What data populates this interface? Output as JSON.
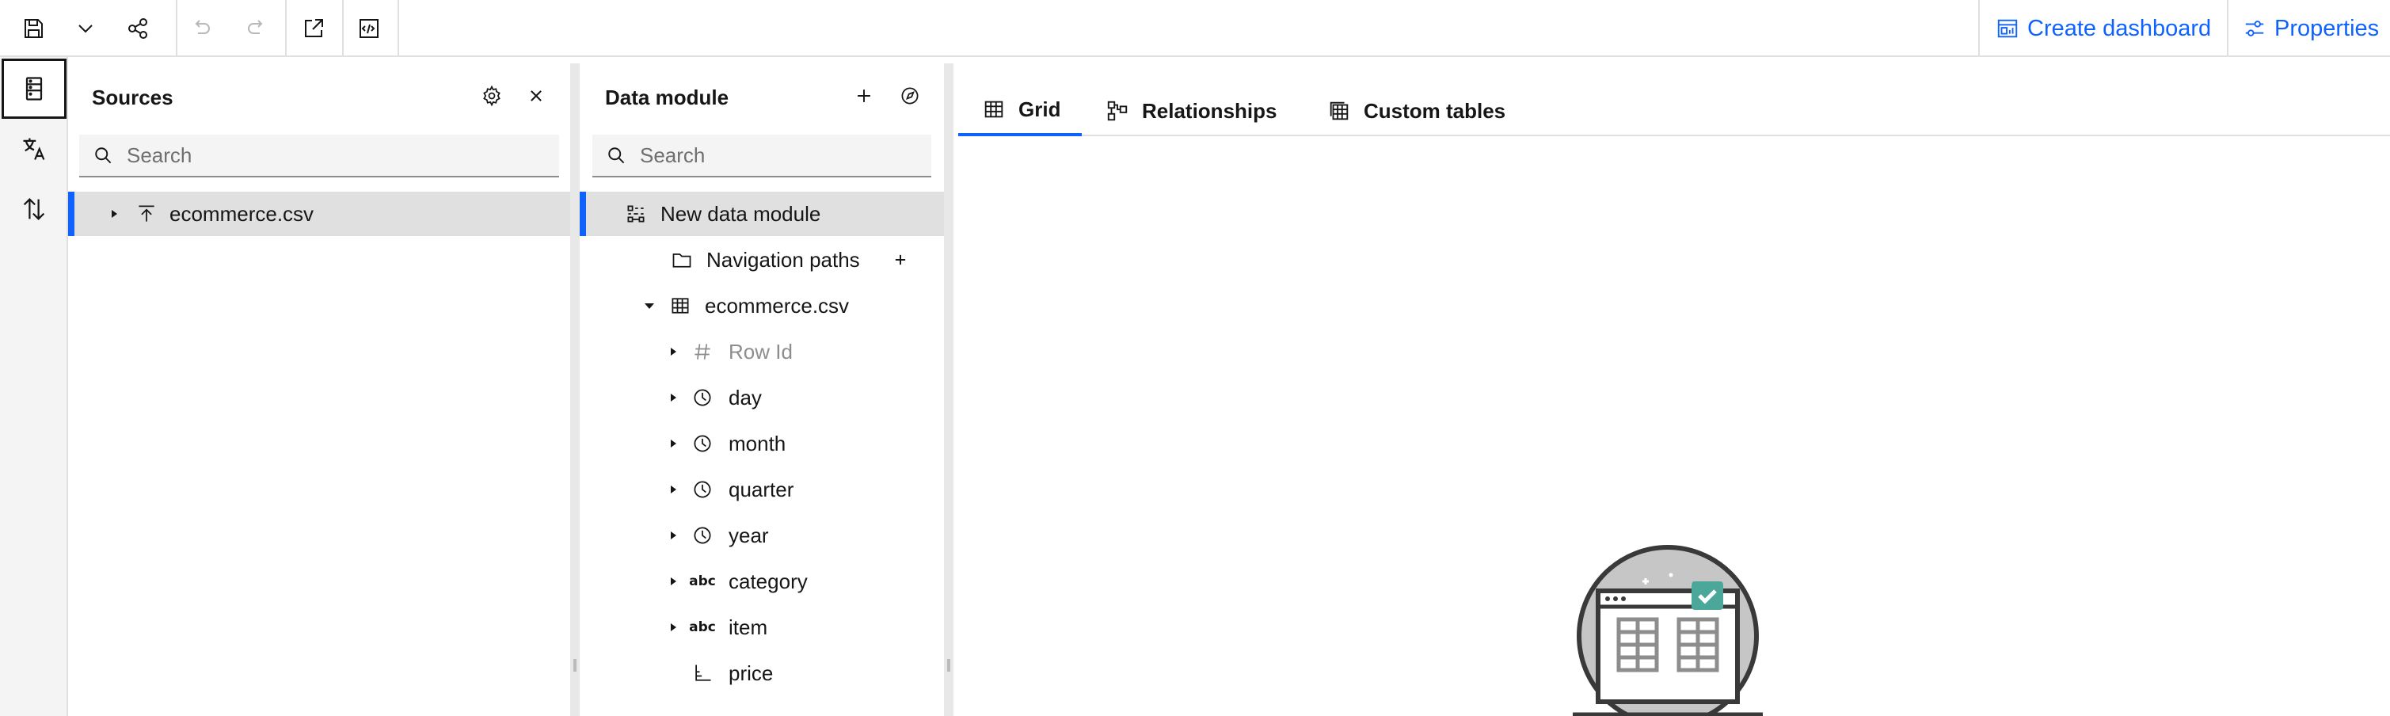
{
  "toolbar": {
    "buttons": [
      {
        "name": "save-icon",
        "enabled": true
      },
      {
        "name": "chevron-down-icon",
        "enabled": true
      },
      {
        "name": "share-icon",
        "enabled": true
      },
      {
        "name": "undo-icon",
        "enabled": false
      },
      {
        "name": "redo-icon",
        "enabled": false
      },
      {
        "name": "launch-icon",
        "enabled": true
      },
      {
        "name": "code-validate-icon",
        "enabled": true
      }
    ],
    "create_dashboard_label": "Create dashboard",
    "properties_label": "Properties"
  },
  "rail": {
    "items": [
      {
        "name": "data-sources-icon",
        "active": true
      },
      {
        "name": "translate-icon",
        "active": false
      },
      {
        "name": "sort-arrows-icon",
        "active": false
      }
    ]
  },
  "sources": {
    "title": "Sources",
    "search_placeholder": "Search",
    "items": [
      {
        "label": "ecommerce.csv",
        "icon": "upload-file-icon",
        "selected": true
      }
    ]
  },
  "data_module": {
    "title": "Data module",
    "search_placeholder": "Search",
    "tree": [
      {
        "label": "New data module",
        "icon": "data-module-icon",
        "selected": true
      },
      {
        "label": "Navigation paths",
        "icon": "folder-icon"
      },
      {
        "label": "ecommerce.csv",
        "icon": "table-icon",
        "expanded": true
      },
      {
        "label": "Row Id",
        "icon": "hash-icon",
        "disabled": true
      },
      {
        "label": "day",
        "icon": "clock-icon"
      },
      {
        "label": "month",
        "icon": "clock-icon"
      },
      {
        "label": "quarter",
        "icon": "clock-icon"
      },
      {
        "label": "year",
        "icon": "clock-icon"
      },
      {
        "label": "category",
        "icon": "abc-icon",
        "icon_text": "abc"
      },
      {
        "label": "item",
        "icon": "abc-icon",
        "icon_text": "abc"
      },
      {
        "label": "price",
        "icon": "measure-icon"
      }
    ]
  },
  "main": {
    "tabs": [
      {
        "label": "Grid",
        "icon": "grid-icon",
        "active": true
      },
      {
        "label": "Relationships",
        "icon": "relationships-icon",
        "active": false
      },
      {
        "label": "Custom tables",
        "icon": "custom-tables-icon",
        "active": false
      }
    ]
  },
  "colors": {
    "accent": "#0f62fe",
    "selected_bg": "#e0e0e0",
    "rail_bg": "#f4f4f4",
    "illustration_teal": "#4aa79a"
  }
}
